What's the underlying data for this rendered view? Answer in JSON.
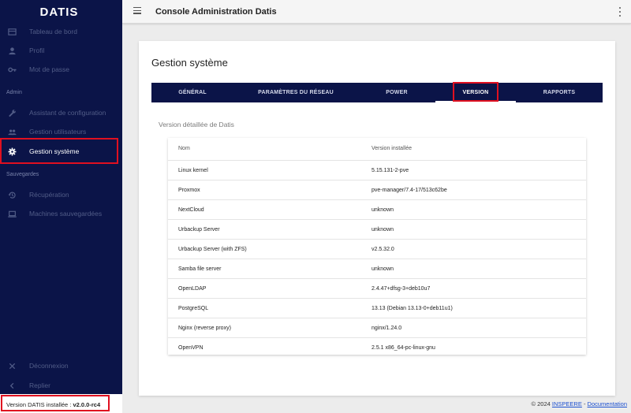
{
  "sidebar": {
    "logo": "DATIS",
    "items": [
      {
        "label": "Tableau de bord",
        "icon": "dashboard-icon"
      },
      {
        "label": "Profil",
        "icon": "person-icon"
      },
      {
        "label": "Mot de passe",
        "icon": "key-icon"
      }
    ],
    "section_admin": "Admin",
    "admin_items": [
      {
        "label": "Assistant de configuration",
        "icon": "wrench-icon"
      },
      {
        "label": "Gestion utilisateurs",
        "icon": "people-icon"
      },
      {
        "label": "Gestion système",
        "icon": "gear-icon"
      }
    ],
    "section_backups": "Sauvegardes",
    "backup_items": [
      {
        "label": "Récupération",
        "icon": "restore-icon"
      },
      {
        "label": "Machines sauvegardées",
        "icon": "laptop-icon"
      }
    ],
    "logout": {
      "label": "Déconnexion",
      "icon": "close-icon"
    },
    "collapse": {
      "label": "Replier",
      "icon": "chevron-left-icon"
    }
  },
  "topbar": {
    "title": "Console Administration Datis"
  },
  "page": {
    "title": "Gestion système",
    "tabs": [
      "GÉNÉRAL",
      "PARAMÈTRES DU RÉSEAU",
      "POWER",
      "VERSION",
      "RAPPORTS"
    ],
    "active_tab": "VERSION",
    "section_title": "Version détaillée de Datis",
    "table": {
      "headers": [
        "Nom",
        "Version installée"
      ],
      "rows": [
        [
          "Linux kernel",
          "5.15.131-2-pve"
        ],
        [
          "Proxmox",
          "pve-manager/7.4-17/513c62be"
        ],
        [
          "NextCloud",
          "unknown"
        ],
        [
          "Urbackup Server",
          "unknown"
        ],
        [
          "Urbackup Server (with ZFS)",
          "v2.5.32.0"
        ],
        [
          "Samba file server",
          "unknown"
        ],
        [
          "OpenLDAP",
          "2.4.47+dfsg-3+deb10u7"
        ],
        [
          "PostgreSQL",
          "13.13 (Debian 13.13-0+deb11u1)"
        ],
        [
          "Nginx (reverse proxy)",
          "nginx/1.24.0"
        ],
        [
          "OpenVPN",
          "2.5.1 x86_64-pc-linux-gnu"
        ]
      ]
    }
  },
  "footer": {
    "version_label": "Version DATIS installée :",
    "version_value": "v2.0.0-rc4",
    "copyright": "© 2024",
    "company_link": "INSPEERE",
    "separator": "-",
    "doc_link": "Documentation"
  },
  "colors": {
    "sidebar_bg": "#0b1448",
    "highlight_red": "#e01020",
    "link_blue": "#1a4fd0"
  }
}
